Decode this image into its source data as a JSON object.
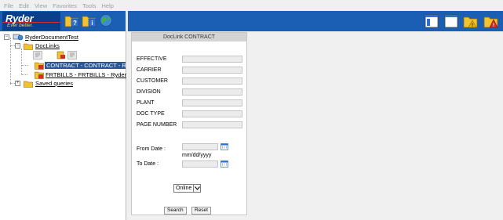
{
  "menu": {
    "items": [
      "File",
      "Edit",
      "View",
      "Favorites",
      "Tools",
      "Help"
    ]
  },
  "toolbar": {
    "logo_word": "Ryder",
    "logo_tagline": "Ever better.",
    "left_icons": [
      "folder-help-icon",
      "folder-info-icon",
      "globe-icon"
    ],
    "right_icons": [
      "window-panel-icon",
      "window-icon",
      "folder-warning-icon",
      "alert-icon"
    ]
  },
  "tree": {
    "root": "RyderDocumentTest",
    "doclinks": "DocLinks",
    "items": [
      "CONTRACT - CONTRACT - Ry",
      "FRTBILLS - FRTBILLS - Ryder"
    ],
    "saved_queries": "Saved queries"
  },
  "form": {
    "title": "DocLink   CONTRACT",
    "fields": [
      {
        "label": "EFFECTIVE",
        "value": ""
      },
      {
        "label": "CARRIER",
        "value": ""
      },
      {
        "label": "CUSTOMER",
        "value": ""
      },
      {
        "label": "DIVISION",
        "value": ""
      },
      {
        "label": "PLANT",
        "value": ""
      },
      {
        "label": "DOC TYPE",
        "value": ""
      },
      {
        "label": "PAGE NUMBER",
        "value": ""
      }
    ],
    "from_date_label": "From Date :",
    "from_date_value": "",
    "date_format_hint": "mm/dd/yyyy",
    "to_date_label": "To Date :",
    "to_date_value": "",
    "mode_selected": "Online",
    "search_label": "Search",
    "reset_label": "Reset"
  },
  "colors": {
    "toolbar_blue": "#1a5fb4",
    "selection_blue": "#2b5797",
    "logo_yellow": "#ffd84a"
  }
}
